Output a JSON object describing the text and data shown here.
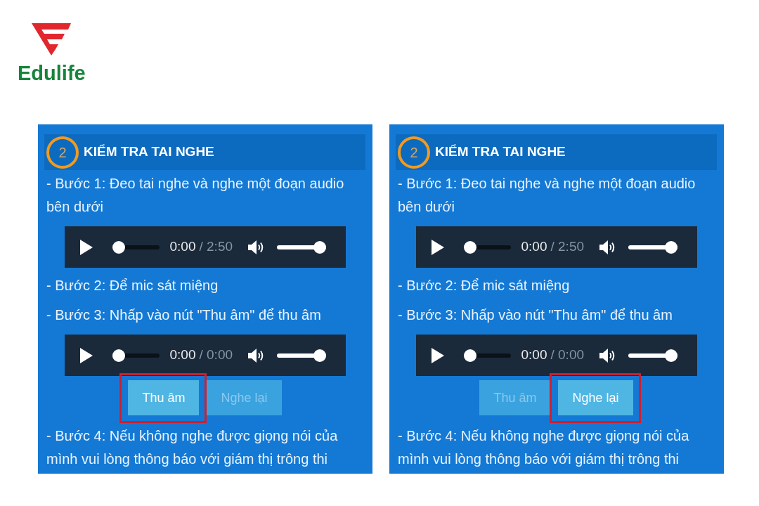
{
  "logo": {
    "text": "Edulife"
  },
  "panels": [
    {
      "header": {
        "number": "2",
        "title": "KIỂM TRA TAI NGHE"
      },
      "blocks": [
        {
          "kind": "step",
          "text": "- Bước 1: Đeo tai nghe và nghe một đoạn audio bên dưới"
        },
        {
          "kind": "player",
          "current_time": "0:00",
          "duration": "/ 2:50",
          "progress": {
            "level": 0
          },
          "volume": {
            "level": 1
          }
        },
        {
          "kind": "step",
          "text": "- Bước 2: Để mic sát miệng"
        },
        {
          "kind": "step",
          "text": "- Bước 3: Nhấp vào nút \"Thu âm\" để thu âm"
        },
        {
          "kind": "player",
          "current_time": "0:00",
          "duration": "/ 0:00",
          "progress": {
            "level": 0
          },
          "volume": {
            "level": 1
          }
        },
        {
          "kind": "buttons",
          "buttons": [
            {
              "label": "Thu âm",
              "disabled": false,
              "highlighted": true
            },
            {
              "label": "Nghe lại",
              "disabled": true,
              "highlighted": false
            }
          ]
        },
        {
          "kind": "step",
          "text": "- Bước 4: Nếu không nghe được giọng nói của mình vui lòng thông báo với giám thị trông thi"
        }
      ]
    },
    {
      "header": {
        "number": "2",
        "title": "KIỂM TRA TAI NGHE"
      },
      "blocks": [
        {
          "kind": "step",
          "text": "- Bước 1: Đeo tai nghe và nghe một đoạn audio bên dưới"
        },
        {
          "kind": "player",
          "current_time": "0:00",
          "duration": "/ 2:50",
          "progress": {
            "level": 0
          },
          "volume": {
            "level": 1
          }
        },
        {
          "kind": "step",
          "text": "- Bước 2: Để mic sát miệng"
        },
        {
          "kind": "step",
          "text": "- Bước 3: Nhấp vào nút \"Thu âm\" để thu âm"
        },
        {
          "kind": "player",
          "current_time": "0:00",
          "duration": "/ 0:00",
          "progress": {
            "level": 0
          },
          "volume": {
            "level": 1
          }
        },
        {
          "kind": "buttons",
          "buttons": [
            {
              "label": "Thu âm",
              "disabled": true,
              "highlighted": false
            },
            {
              "label": "Nghe lại",
              "disabled": false,
              "highlighted": true
            }
          ]
        },
        {
          "kind": "step",
          "text": "- Bước 4: Nếu không nghe được giọng nói của mình vui lòng thông báo với giám thị trông thi"
        }
      ]
    }
  ]
}
